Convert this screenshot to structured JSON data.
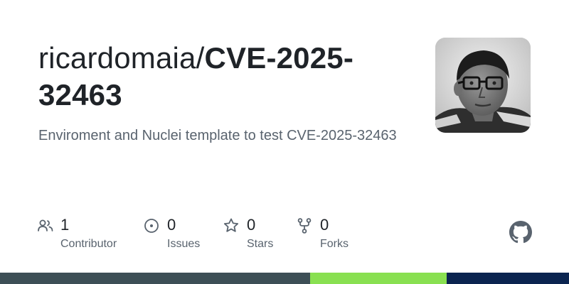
{
  "repo": {
    "owner": "ricardomaia/",
    "name": "CVE-2025-32463",
    "description": "Enviroment and Nuclei template to test CVE-2025-32463"
  },
  "avatar": {
    "icon": "user-avatar-photo"
  },
  "stats": [
    {
      "icon": "people-icon",
      "count": "1",
      "label": "Contributor"
    },
    {
      "icon": "issue-circle-icon",
      "count": "0",
      "label": "Issues"
    },
    {
      "icon": "star-icon",
      "count": "0",
      "label": "Stars"
    },
    {
      "icon": "fork-icon",
      "count": "0",
      "label": "Forks"
    }
  ],
  "logo": {
    "icon": "github-logo-icon"
  },
  "language_bar": [
    {
      "color": "#3d4f56",
      "fraction": 0.545
    },
    {
      "color": "#89e051",
      "fraction": 0.24
    },
    {
      "color": "#0b2450",
      "fraction": 0.215
    }
  ]
}
